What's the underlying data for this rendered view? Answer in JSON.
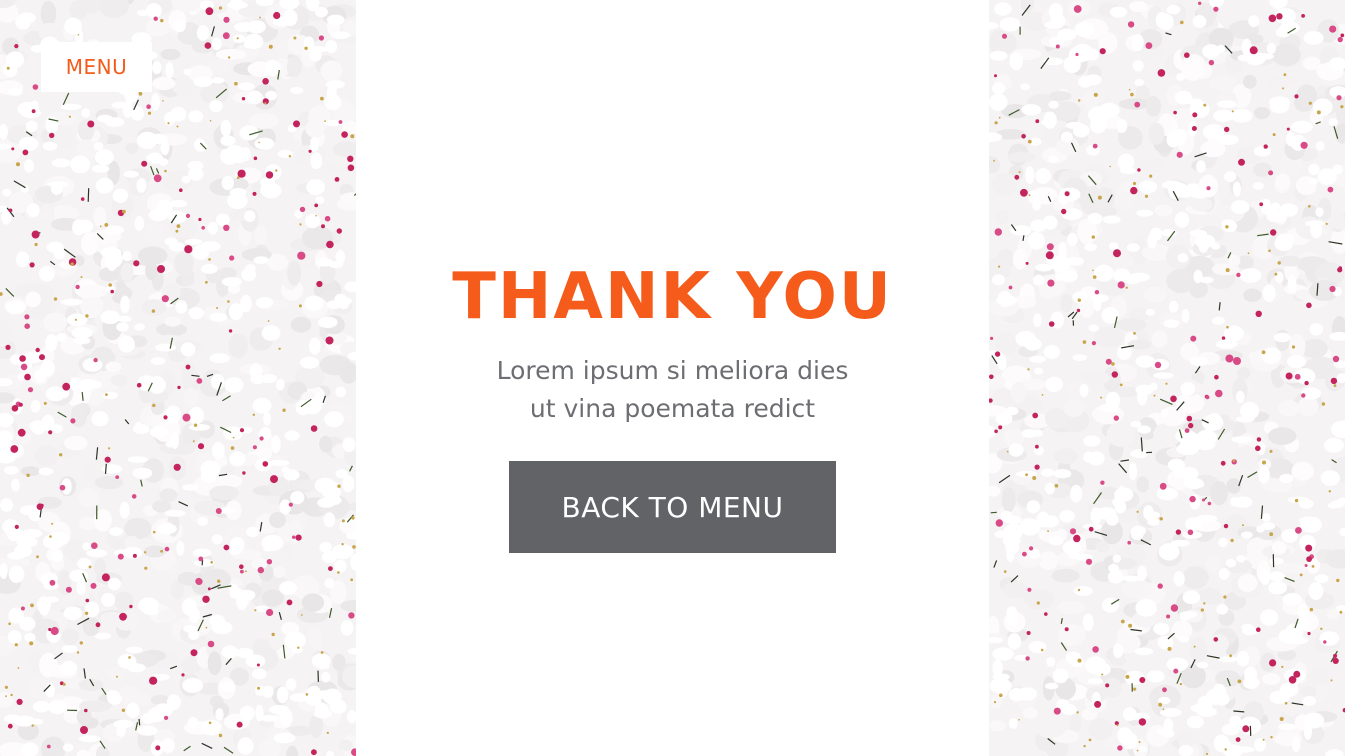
{
  "nav": {
    "menu_label": "MENU"
  },
  "main": {
    "title": "THANK YOU",
    "subtitle_lines": [
      "Lorem ipsum si meliora dies",
      "ut vina poemata redict"
    ],
    "back_button_label": "BACK TO MENU"
  },
  "colors": {
    "accent": "#f55c1b",
    "button_bg": "#626366",
    "text_gray": "#6d6e72",
    "background": "#ffffff"
  },
  "images": {
    "left_panel": "white-orchid-flowers-background",
    "right_panel": "white-orchid-flowers-background"
  }
}
